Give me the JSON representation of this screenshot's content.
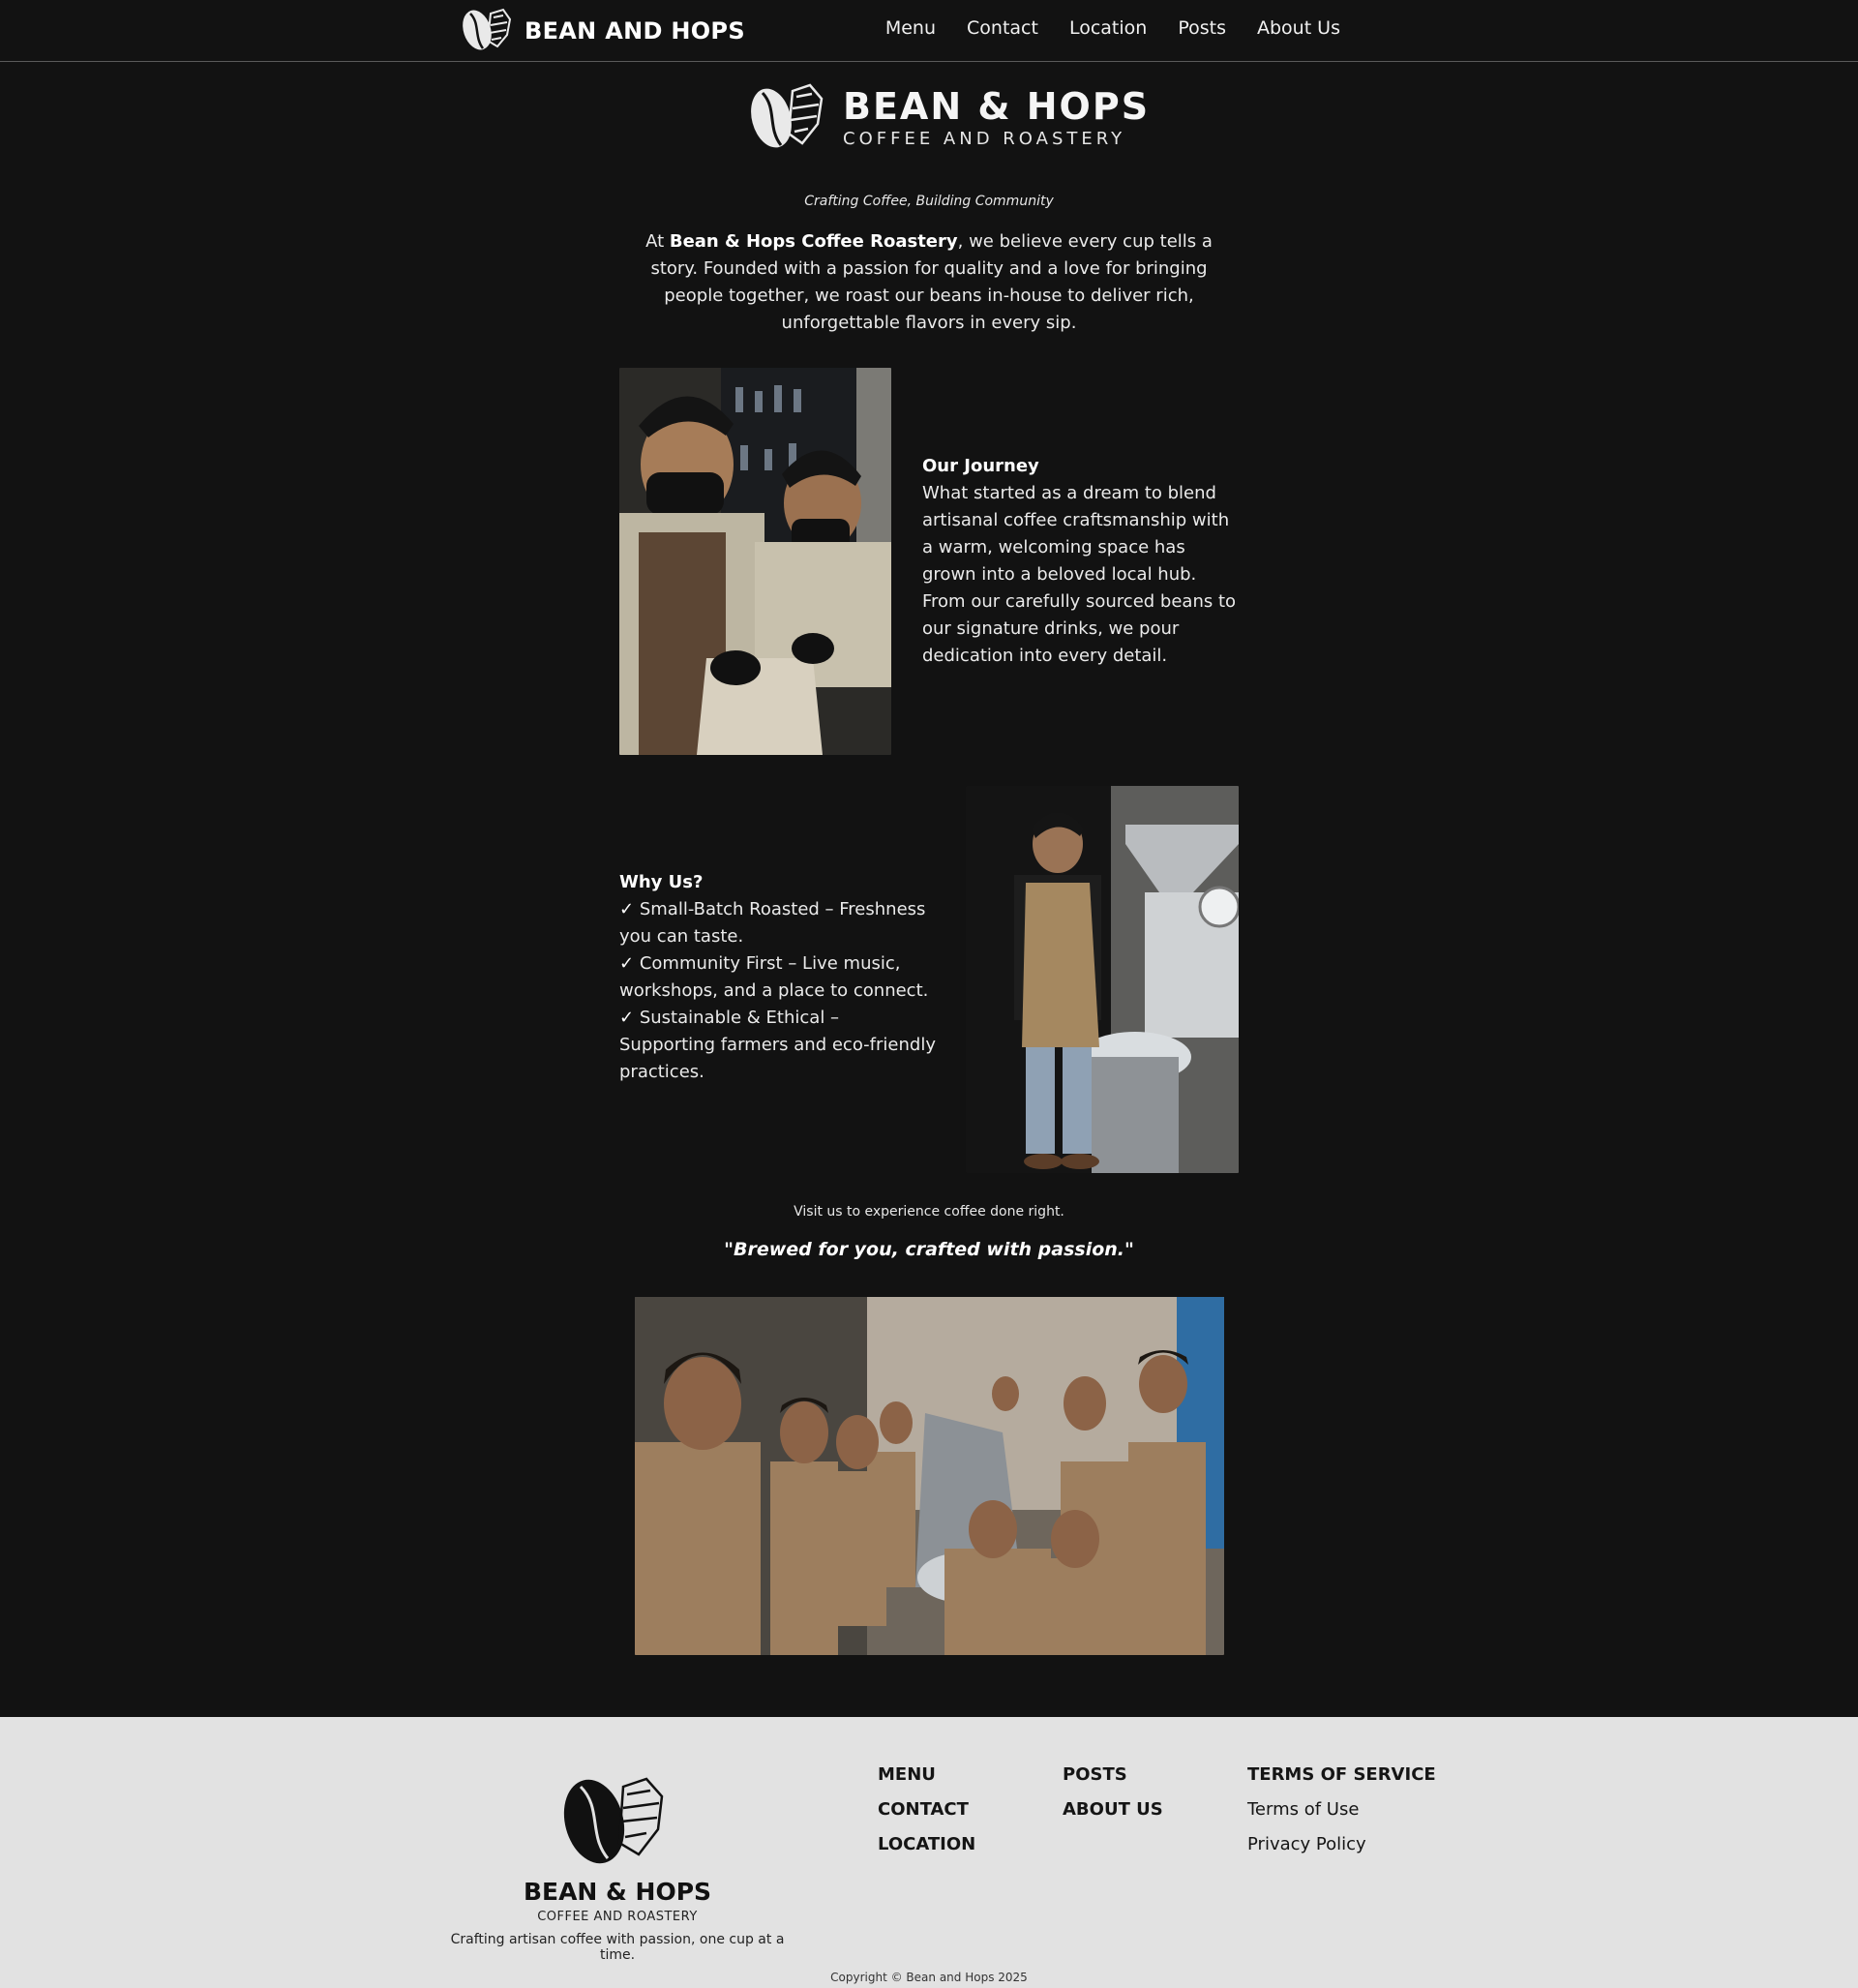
{
  "header": {
    "brand": "BEAN AND HOPS",
    "nav": [
      "Menu",
      "Contact",
      "Location",
      "Posts",
      "About Us"
    ]
  },
  "hero": {
    "title": "BEAN & HOPS",
    "subtitle": "COFFEE AND ROASTERY",
    "tagline": "Crafting Coffee, Building Community",
    "intro_prefix": "At ",
    "intro_bold": "Bean & Hops Coffee Roastery",
    "intro_rest": ", we believe every cup tells a story. Founded with a passion for quality and a love for bringing people together, we roast our beans in-house to deliver rich, unforgettable flavors in every sip."
  },
  "journey": {
    "heading": "Our Journey",
    "body": "What started as a dream to blend artisanal coffee craftsmanship with a warm, welcoming space has grown into a beloved local hub. From our carefully sourced beans to our signature drinks, we pour dedication into every detail."
  },
  "why": {
    "heading": "Why Us?",
    "items": [
      "Small-Batch Roasted – Freshness you can taste.",
      "Community First – Live music, workshops, and a place to connect.",
      "Sustainable & Ethical – Supporting farmers and eco-friendly practices."
    ],
    "check": "✓"
  },
  "closing": {
    "visit": "Visit us to experience coffee done right.",
    "quote": "\"Brewed for you, crafted with passion.\""
  },
  "footer": {
    "brand_title": "BEAN & HOPS",
    "brand_sub": "COFFEE AND ROASTERY",
    "brand_desc": "Crafting artisan coffee with passion, one cup at a time.",
    "col1": [
      "MENU",
      "CONTACT",
      "LOCATION"
    ],
    "col2": [
      "POSTS",
      "ABOUT US"
    ],
    "col3_title": "TERMS OF SERVICE",
    "col3": [
      "Terms of Use",
      "Privacy Policy"
    ],
    "copyright": "Copyright © Bean and Hops 2025"
  },
  "colors": {
    "background": "#121212",
    "footer_background": "#e2e2e2",
    "text_light": "#f2f2f2",
    "text_dark": "#151515"
  },
  "icons": {
    "logo": "coffee-bean-and-hop-icon"
  }
}
